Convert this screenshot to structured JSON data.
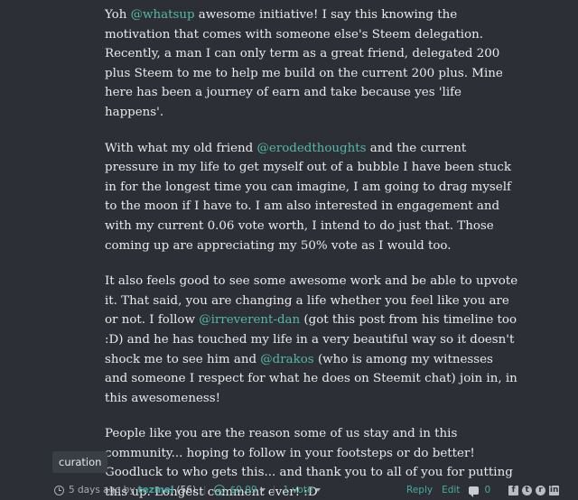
{
  "comment": {
    "paragraphs": [
      [
        {
          "t": "Yoh "
        },
        {
          "m": "@whatsup"
        },
        {
          "t": " awesome initiative! I say this knowing the motivation that comes with someone else's Steem delegation. Recently, a man I can only term as a great friend, delegated 200 plus Steem to me to help me build on the current 200 plus. Mine here has been a journey of earn and take because yes 'life happens'."
        }
      ],
      [
        {
          "t": "With what my old friend "
        },
        {
          "m": "@erodedthoughts"
        },
        {
          "t": " and the current pressure in my life to get myself out of a bubble I have been stuck in for the longest time you can imagine, I am going to drag myself to the moon if I have to. I am also interested in engagement and with my current 0.06 vote worth, I intend to do just that. Those coming up are appreciating my 50% vote as I would too."
        }
      ],
      [
        {
          "t": "It also feels good to see some awesome work and be able to upvote it. That said, you are changing a life whether you feel like you are or not. I follow "
        },
        {
          "m": "@irreverent-dan"
        },
        {
          "t": " (got this post from his timeline too :D) and he has touched my life in a very beautiful way so it doesn't shock me to see him and "
        },
        {
          "m": "@drakos"
        },
        {
          "t": " (who is among my witnesses and someone I respect for what he does on Steemit chat) join in, in this awesomeness!"
        }
      ],
      [
        {
          "t": "People like you are the reason some of us stay and in this community... hoping to follow in your footsteps or do better! Goodluck to who gets this... and thank you to all of you for putting this up. Longest comment ever! :D"
        }
      ]
    ]
  },
  "tag": "curation",
  "footer": {
    "time": "5 days ago",
    "by": "by",
    "author": "tezmel",
    "reputation": "(56)",
    "payout": "$0.09",
    "votes": "1 vote",
    "reply": "Reply",
    "edit": "Edit",
    "comment_count": "0",
    "share_icons": [
      "facebook-icon",
      "twitter-icon",
      "reddit-icon",
      "linkedin-icon"
    ]
  },
  "colors": {
    "background": "#2c3036",
    "text": "#eaeaea",
    "link": "#55b8a8"
  }
}
